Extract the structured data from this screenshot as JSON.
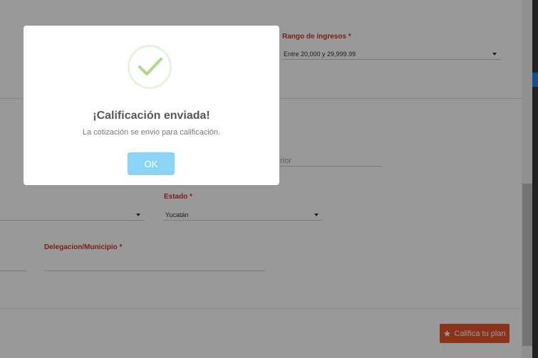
{
  "form": {
    "rango_label": "Rango de ingresos *",
    "rango_value": "Entre 20,000 y 29,999.99",
    "anterior_placeholder": "rior",
    "estado_label": "Estado *",
    "estado_value": "Yucatán",
    "delegacion_label": "Delegacion/Municipio *",
    "delegacion_value": ""
  },
  "modal": {
    "title": "¡Calificación enviada!",
    "message": "La cotización se envio para calificación.",
    "ok_label": "OK"
  },
  "actions": {
    "califica_label": "Califica tu plan"
  },
  "colors": {
    "accent_orange": "#e8562a",
    "label_red": "#d32f2f",
    "ok_button": "#8cd4f5",
    "success_check": "#a5dc86"
  },
  "icons": {
    "success": "check-icon",
    "califica": "star-icon"
  }
}
